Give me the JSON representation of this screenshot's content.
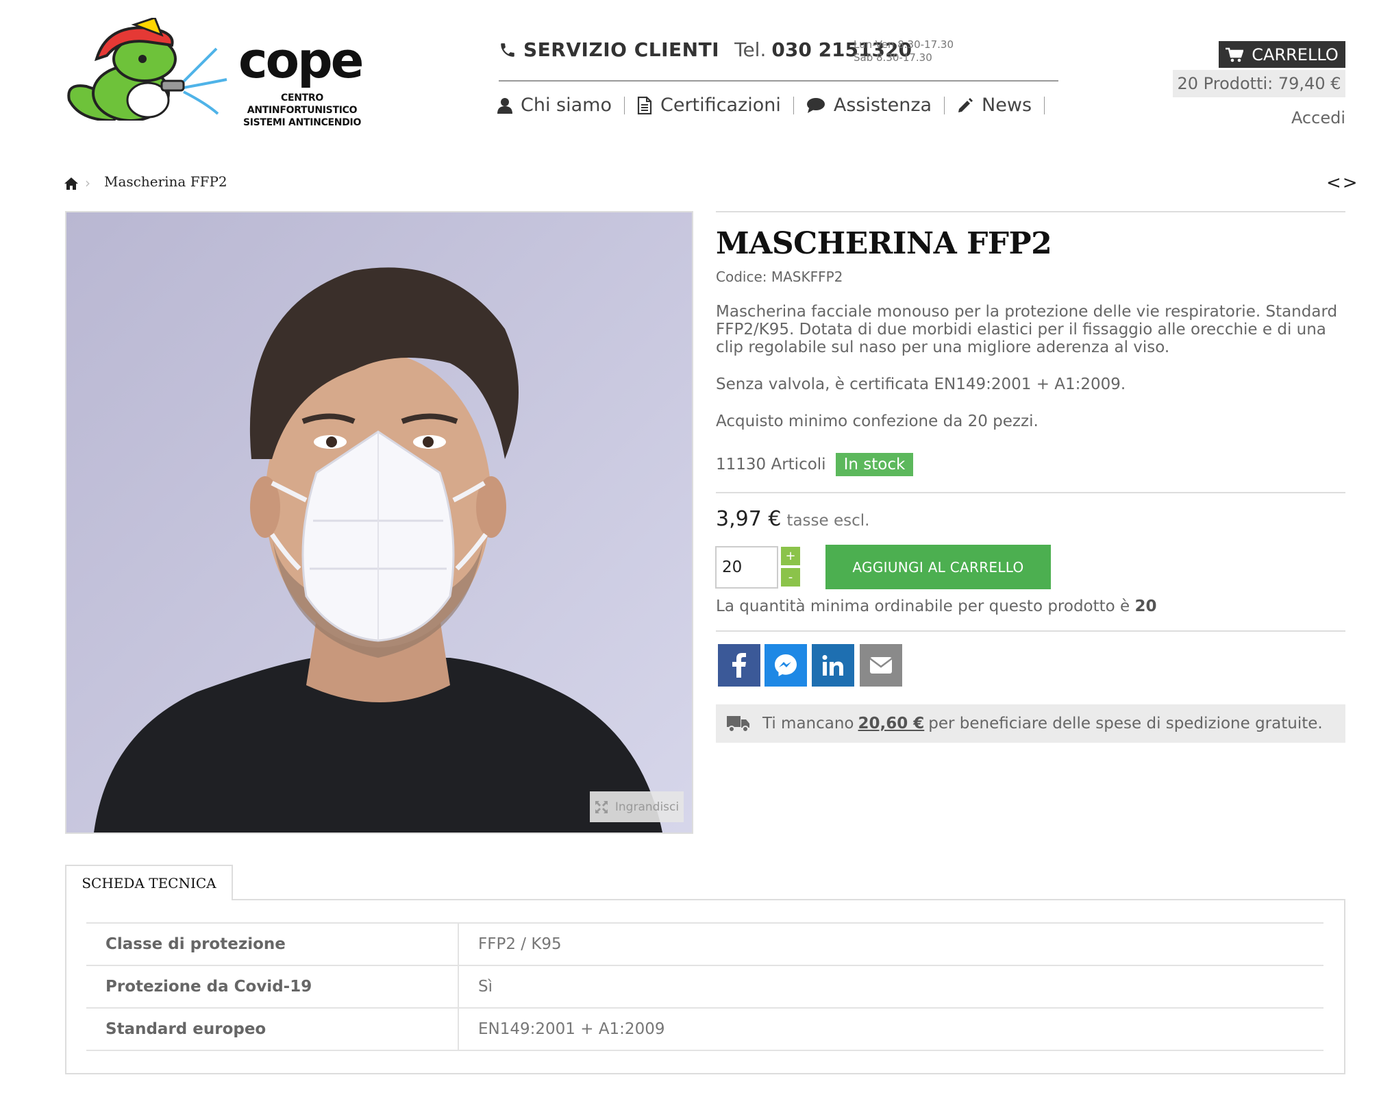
{
  "brand": {
    "name": "cope",
    "tagline_line1": "CENTRO ANTINFORTUNISTICO",
    "tagline_line2": "SISTEMI ANTINCENDIO"
  },
  "contact": {
    "label": "SERVIZIO CLIENTI",
    "tel_prefix": "Tel.",
    "tel_number": "030 2151320",
    "hours_line1": "Lun-Ven 8.30-17.30",
    "hours_line2": "Sab 8.30-17.30"
  },
  "nav": {
    "items": [
      {
        "label": "Chi siamo",
        "icon": "user-icon"
      },
      {
        "label": "Certificazioni",
        "icon": "document-icon"
      },
      {
        "label": "Assistenza",
        "icon": "chat-icon"
      },
      {
        "label": "News",
        "icon": "pencil-icon"
      }
    ]
  },
  "cart": {
    "label": "CARRELLO",
    "summary": "20 Prodotti: 79,40 €",
    "login_label": "Accedi"
  },
  "breadcrumb": {
    "current": "Mascherina FFP2",
    "prevnext": "<>"
  },
  "product": {
    "title": "MASCHERINA FFP2",
    "code": "Codice: MASKFFP2",
    "description_p1": "Mascherina facciale monouso per la protezione delle vie respiratorie. Standard FFP2/K95. Dotata di due morbidi elastici per il fissaggio alle orecchie e di una clip regolabile sul naso per una migliore aderenza al viso.",
    "description_p2": "Senza valvola, è certificata EN149:2001 + A1:2009.",
    "description_p3": "Acquisto minimo confezione da 20 pezzi.",
    "stock_count": "11130 Articoli",
    "stock_status": "In stock",
    "price": "3,97 €",
    "price_tax": "tasse escl.",
    "quantity": "20",
    "qty_plus": "+",
    "qty_minus": "-",
    "add_to_cart": "AGGIUNGI AL CARRELLO",
    "min_qty_text": "La quantità minima ordinabile per questo prodotto è",
    "min_qty_value": "20",
    "zoom_label": "Ingrandisci"
  },
  "shipping": {
    "prefix": "Ti mancano",
    "amount": "20,60 €",
    "suffix": "per beneficiare delle spese di spedizione gratuite."
  },
  "share_buttons": [
    "facebook-icon",
    "messenger-icon",
    "linkedin-icon",
    "email-icon"
  ],
  "tech_sheet": {
    "tab_label": "SCHEDA TECNICA",
    "rows": [
      {
        "key": "Classe di protezione",
        "value": "FFP2 / K95"
      },
      {
        "key": "Protezione da Covid-19",
        "value": "Sì"
      },
      {
        "key": "Standard europeo",
        "value": "EN149:2001 + A1:2009"
      }
    ]
  },
  "colors": {
    "accent_green": "#4caf50",
    "stock_green": "#5cb85c",
    "qty_green": "#8bc34a",
    "dark": "#333333",
    "facebook": "#3b5998",
    "messenger": "#1e88e5",
    "linkedin": "#1e6fb1",
    "email": "#8a8a8a"
  }
}
